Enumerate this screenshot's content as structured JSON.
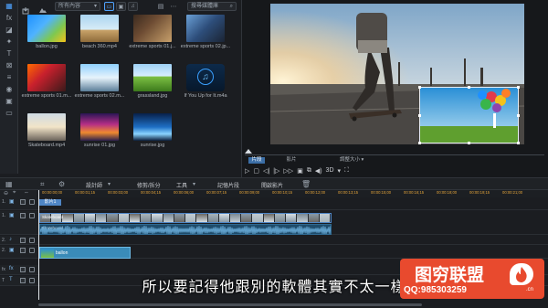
{
  "library": {
    "filter_label": "所有內容",
    "search_placeholder": "搜尋媒體庫"
  },
  "media": [
    {
      "name": "ballon.jpg",
      "kind": "balloon"
    },
    {
      "name": "beach 360.mp4",
      "kind": "beach"
    },
    {
      "name": "extreme sports 01.j...",
      "kind": "sport1"
    },
    {
      "name": "extreme sports 02.jp...",
      "kind": "sport2"
    },
    {
      "name": "extreme sports 01.m...",
      "kind": "sport3"
    },
    {
      "name": "extreme sports 02.m...",
      "kind": "sport4"
    },
    {
      "name": "grassland.jpg",
      "kind": "grass"
    },
    {
      "name": "If You Up for It.m4a",
      "kind": "audio"
    },
    {
      "name": "Skateboard.mp4",
      "kind": "skate"
    },
    {
      "name": "sunrise 01.jpg",
      "kind": "sunrise1"
    },
    {
      "name": "sunrise.jpg",
      "kind": "sunrise2"
    }
  ],
  "preview": {
    "tab_clip": "片段",
    "tab_movie": "影片",
    "zoom_label": "調整大小",
    "three_d": "3D"
  },
  "timeline_toolbar": {
    "split": "設計師",
    "transition": "修剪/拆分",
    "tools": "工具",
    "keyframes": "記憶片段",
    "render": "開啟影片"
  },
  "ruler": {
    "marks": [
      "00:00:00;00",
      "00:00:01;15",
      "00:00:03;00",
      "00:00:04;15",
      "00:00:06;00",
      "00:00:07;15",
      "00:00:09;00",
      "00:00:10;15",
      "00:00:12;00",
      "00:00:13;15",
      "00:00:15;00",
      "00:00:16;15",
      "00:00:18;00",
      "00:00:19;15",
      "00:00:21;00"
    ]
  },
  "tracks": {
    "labels": [
      "1.",
      "1.",
      "2.",
      "2.",
      "fx",
      "T"
    ],
    "clip_tag": "影片1",
    "video_clip_label": "Skateboard",
    "audio_clip_label": "Skateboard",
    "image_clip_label": "ballon"
  },
  "subtitle": "所以要記得他跟別的軟體其實不太一樣",
  "watermark": {
    "brand": "图穷联盟",
    "qq": "QQ:985303259",
    "site": ".cn"
  }
}
